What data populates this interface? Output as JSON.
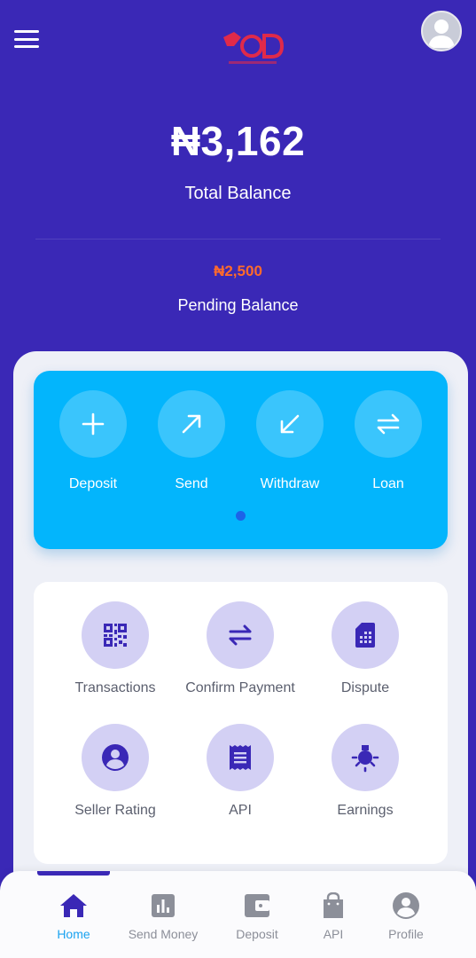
{
  "header": {
    "logo_text": "POD",
    "logo_sub": "SECURE PAY"
  },
  "balance": {
    "amount": "₦3,162",
    "label": "Total Balance"
  },
  "pending": {
    "amount": "₦2,500",
    "label": "Pending Balance"
  },
  "actions": [
    {
      "label": "Deposit",
      "icon": "plus-icon"
    },
    {
      "label": "Send",
      "icon": "arrow-up-right-icon"
    },
    {
      "label": "Withdraw",
      "icon": "arrow-down-left-icon"
    },
    {
      "label": "Loan",
      "icon": "swap-arrows-icon"
    }
  ],
  "pager": {
    "pages": 1,
    "active": 1
  },
  "services": [
    {
      "label": "Transactions",
      "icon": "qr-code-icon"
    },
    {
      "label": "Confirm Payment",
      "icon": "swap-arrows-icon"
    },
    {
      "label": "Dispute",
      "icon": "sim-card-icon"
    },
    {
      "label": "Seller Rating",
      "icon": "account-circle-icon"
    },
    {
      "label": "API",
      "icon": "receipt-icon"
    },
    {
      "label": "Earnings",
      "icon": "lightbulb-icon"
    }
  ],
  "nav": [
    {
      "label": "Home",
      "icon": "home-icon",
      "active": true
    },
    {
      "label": "Send Money",
      "icon": "bar-chart-icon",
      "active": false
    },
    {
      "label": "Deposit",
      "icon": "wallet-icon",
      "active": false
    },
    {
      "label": "API",
      "icon": "shopping-bag-icon",
      "active": false
    },
    {
      "label": "Profile",
      "icon": "account-circle-icon",
      "active": false
    }
  ],
  "colors": {
    "background": "#3a28b6",
    "action_card": "#03b5fc",
    "pending_amount": "#ff6a2b",
    "service_circle": "#d3d0f4",
    "service_icon": "#3a28b6",
    "nav_active": "#1aa3f0"
  }
}
